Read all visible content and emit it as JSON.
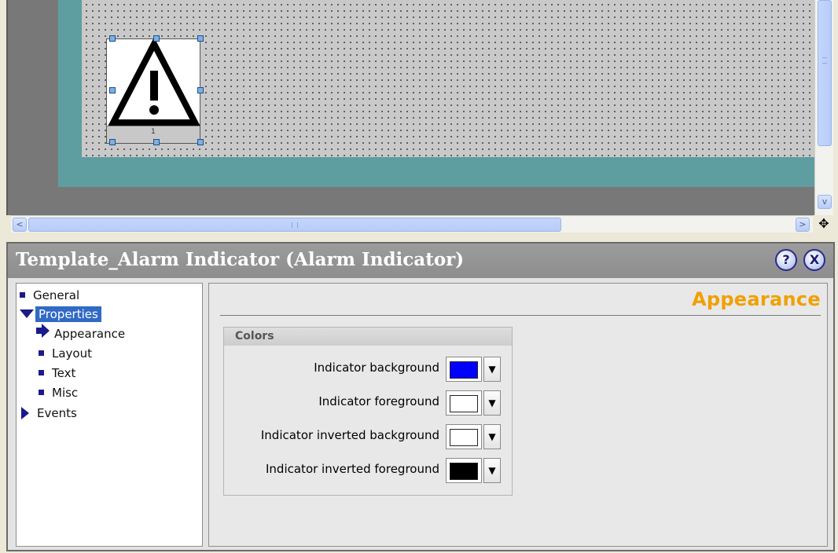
{
  "editor": {
    "indicator_digit": "1",
    "scrollbar_grip": "III",
    "scroll_left": "<",
    "scroll_right": ">",
    "scroll_down": "v",
    "move_glyph": "✥"
  },
  "inspector": {
    "title": "Template_Alarm Indicator (Alarm Indicator)",
    "pin_glyph": "?",
    "close_glyph": "X",
    "tree": {
      "general": "General",
      "properties": "Properties",
      "appearance": "Appearance",
      "layout": "Layout",
      "text": "Text",
      "misc": "Misc",
      "events": "Events"
    },
    "section_title": "Appearance",
    "group_title": "Colors",
    "rows": [
      {
        "label": "Indicator background",
        "color": "#0000ff"
      },
      {
        "label": "Indicator foreground",
        "color": "#ffffff"
      },
      {
        "label": "Indicator inverted background",
        "color": "#ffffff"
      },
      {
        "label": "Indicator inverted foreground",
        "color": "#000000"
      }
    ],
    "dropdown_glyph": "▼"
  },
  "colors": {
    "canvas_frame": "#787878",
    "screen": "#5f9ea0",
    "accent_title": "#f0a000",
    "selection": "#316ac5"
  }
}
